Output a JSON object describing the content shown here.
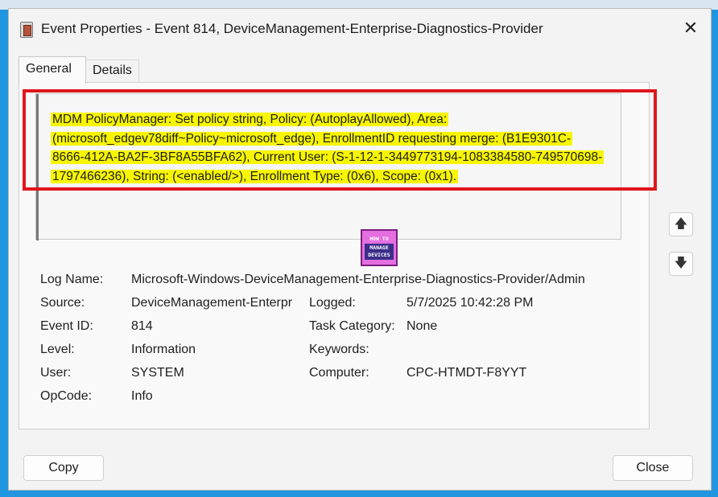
{
  "window": {
    "title": "Event Properties - Event 814, DeviceManagement-Enterprise-Diagnostics-Provider",
    "close_glyph": "✕"
  },
  "tabs": [
    {
      "label": "General"
    },
    {
      "label": "Details"
    }
  ],
  "description": {
    "line1": "MDM PolicyManager: Set policy string, Policy: (AutoplayAllowed), Area:",
    "line2": "(microsoft_edgev78diff~Policy~microsoft_edge), EnrollmentID requesting merge: (B1E9301C-",
    "line3": "8666-412A-BA2F-3BF8A55BFA62), Current User: (S-1-12-1-3449773194-1083384580-749570698-",
    "line4": "1797466236), String: (<enabled/>), Enrollment Type: (0x6), Scope: (0x1)."
  },
  "logo": {
    "top": "HOW TO",
    "bottom": "MANAGE DEVICES"
  },
  "fields": {
    "log_name_label": "Log Name:",
    "log_name_value": "Microsoft-Windows-DeviceManagement-Enterprise-Diagnostics-Provider/Admin",
    "source_label": "Source:",
    "source_value": "DeviceManagement-Enterpr",
    "logged_label": "Logged:",
    "logged_value": "5/7/2025 10:42:28 PM",
    "event_id_label": "Event ID:",
    "event_id_value": "814",
    "task_category_label": "Task Category:",
    "task_category_value": "None",
    "level_label": "Level:",
    "level_value": "Information",
    "keywords_label": "Keywords:",
    "keywords_value": "",
    "user_label": "User:",
    "user_value": "SYSTEM",
    "computer_label": "Computer:",
    "computer_value": "CPC-HTMDT-F8YYT",
    "opcode_label": "OpCode:",
    "opcode_value": "Info"
  },
  "buttons": {
    "copy": "Copy",
    "close": "Close",
    "up_glyph": "🡅",
    "down_glyph": "🡇"
  },
  "colors": {
    "background": "#2196e0",
    "highlight": "#f7f500",
    "frame": "#e0161c"
  }
}
